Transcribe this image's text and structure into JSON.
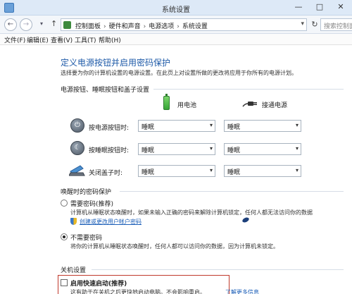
{
  "window": {
    "title": "系统设置",
    "minimize_glyph": "—",
    "maximize_glyph": "□",
    "close_glyph": "✕"
  },
  "address_bar": {
    "back_glyph": "←",
    "forward_glyph": "→",
    "up_glyph": "↑",
    "dropdown_glyph": "▾",
    "refresh_glyph": "↻",
    "breadcrumbs": [
      "控制面板",
      "硬件和声音",
      "电源选项",
      "系统设置"
    ],
    "separator": "›",
    "search_placeholder": "搜索控制面板"
  },
  "menu": {
    "items": [
      "文件(F)",
      "编辑(E)",
      "查看(V)",
      "工具(T)",
      "帮助(H)"
    ]
  },
  "page": {
    "heading": "定义电源按钮并启用密码保护",
    "subtitle": "选择要为你的计算机设置的电源设置。在此页上对设置所做的更改将应用于你所有的电源计划。"
  },
  "power_buttons": {
    "section_title": "电源按钮、睡眠按钮和盖子设置",
    "col_battery": "用电池",
    "col_plugged": "接通电源",
    "rows": [
      {
        "label": "按电源按钮时:",
        "battery": "睡眠",
        "plugged": "睡眠",
        "icon": "power-button-icon"
      },
      {
        "label": "按睡眠按钮时:",
        "battery": "睡眠",
        "plugged": "睡眠",
        "icon": "sleep-button-icon"
      },
      {
        "label": "关闭盖子时:",
        "battery": "睡眠",
        "plugged": "睡眠",
        "icon": "laptop-lid-icon"
      }
    ],
    "select_arrow": "▾"
  },
  "wake_password": {
    "section_title": "唤醒时的密码保护",
    "require": {
      "label": "需要密码(推荐)",
      "desc": "计算机从睡眠状态唤醒时，如果未输入正确的密码来解除计算机锁定，任何人都无法访问你的数据",
      "link": "创建或更改用户帐户密码",
      "checked": false
    },
    "no_require": {
      "label": "不需要密码",
      "desc": "将你的计算机从睡眠状态唤醒时，任何人都可以访问你的数据，因为计算机未锁定。",
      "checked": true
    }
  },
  "shutdown": {
    "section_title": "关机设置",
    "fast_startup_label": "启用快速启动(推荐)",
    "fast_startup_desc": "这有助于在关机之后更快地启动电脑。不会影响重启。",
    "learn_more": "了解更多信息",
    "fast_startup_checked": false
  }
}
